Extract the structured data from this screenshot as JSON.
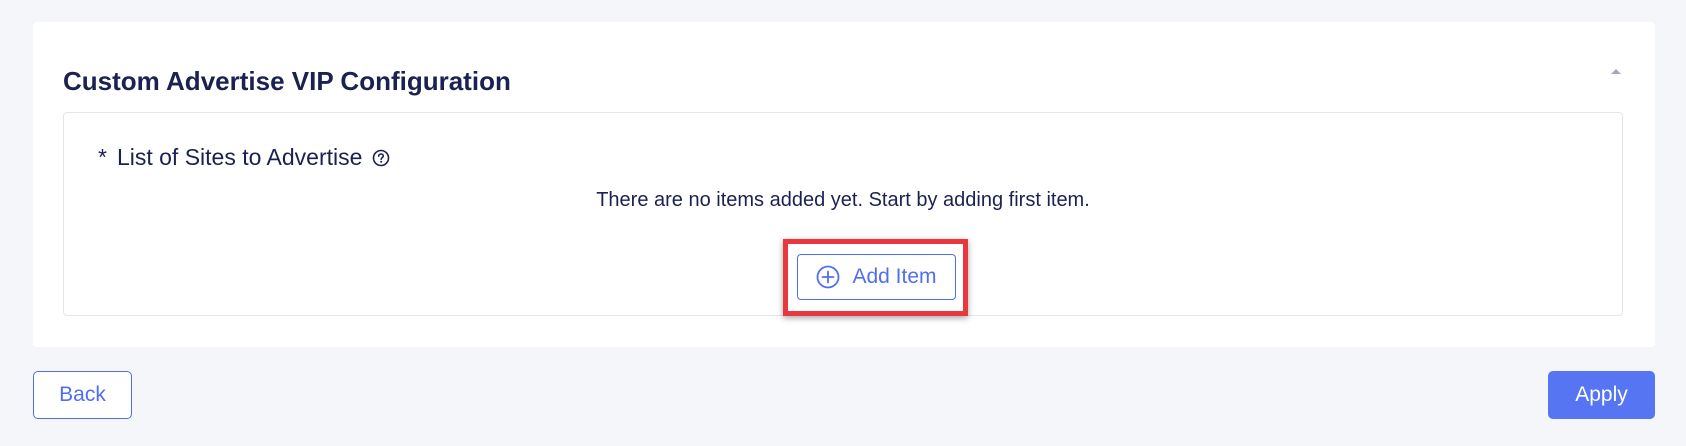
{
  "section": {
    "title": "Custom Advertise VIP Configuration",
    "collapse_icon": "chevron-up-icon"
  },
  "field": {
    "required_marker": "*",
    "label": "List of Sites to Advertise",
    "help_icon": "question-circle-icon",
    "empty_message": "There are no items added yet. Start by adding first item.",
    "add_button_label": "Add Item",
    "add_button_icon": "plus-circle-icon"
  },
  "footer": {
    "back_label": "Back",
    "apply_label": "Apply"
  },
  "colors": {
    "accent": "#5575f3",
    "heading": "#1b2150",
    "highlight": "#e8373e",
    "background": "#f5f6f9"
  }
}
